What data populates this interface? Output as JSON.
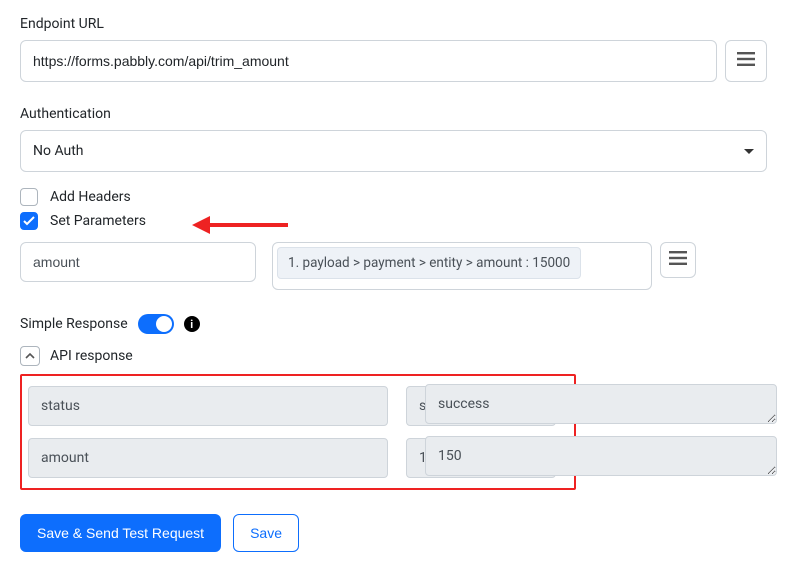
{
  "endpoint": {
    "label": "Endpoint URL",
    "value": "https://forms.pabbly.com/api/trim_amount"
  },
  "auth": {
    "label": "Authentication",
    "value": "No Auth"
  },
  "headers": {
    "checkbox_label": "Add Headers",
    "checked": false
  },
  "params": {
    "checkbox_label": "Set Parameters",
    "checked": true,
    "rows": [
      {
        "key": "amount",
        "value_tag": "1. payload > payment > entity > amount : 15000"
      }
    ]
  },
  "simple_response": {
    "label": "Simple Response",
    "on": true
  },
  "api_response": {
    "label": "API response",
    "rows": [
      {
        "key": "status",
        "value": "success"
      },
      {
        "key": "amount",
        "value": "150"
      }
    ]
  },
  "buttons": {
    "save_send": "Save & Send Test Request",
    "save": "Save"
  },
  "icons": {
    "hamburger": "menu-icon",
    "info": "i"
  }
}
